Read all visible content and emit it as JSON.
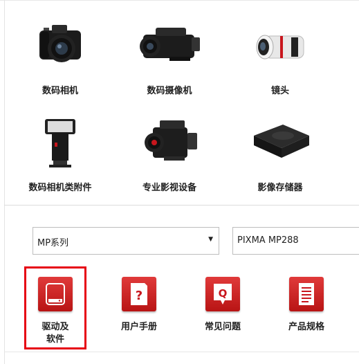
{
  "categories": [
    {
      "label": "数码相机",
      "icon": "camera-icon"
    },
    {
      "label": "数码摄像机",
      "icon": "camcorder-icon"
    },
    {
      "label": "镜头",
      "icon": "lens-icon"
    },
    {
      "label": "数码相机类附件",
      "icon": "flash-icon"
    },
    {
      "label": "专业影视设备",
      "icon": "cinema-camera-icon"
    },
    {
      "label": "影像存储器",
      "icon": "storage-icon"
    }
  ],
  "selectors": {
    "series": "MP系列",
    "model": "PIXMA MP288"
  },
  "support": [
    {
      "label": "驱动及软件",
      "icon": "drive-icon"
    },
    {
      "label": "用户手册",
      "icon": "manual-icon"
    },
    {
      "label": "常见问题",
      "icon": "faq-icon"
    },
    {
      "label": "产品规格",
      "icon": "spec-icon"
    }
  ],
  "colors": {
    "accent_red": "#c8161d",
    "highlight": "#e60012"
  }
}
